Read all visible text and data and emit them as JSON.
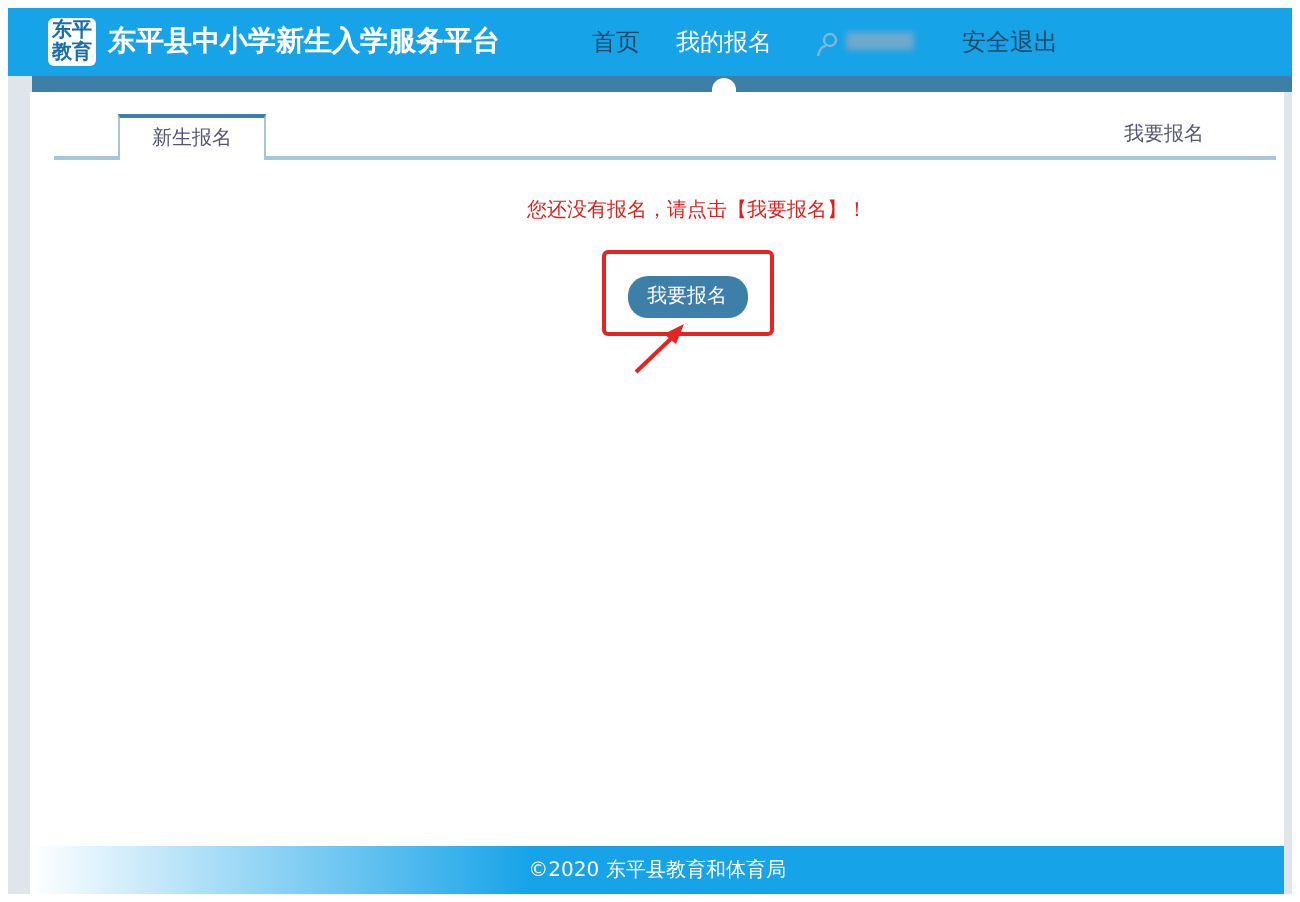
{
  "header": {
    "logo_text": [
      "东平",
      "教育"
    ],
    "title": "东平县中小学新生入学服务平台",
    "nav": [
      {
        "label": "首页",
        "selected": false
      },
      {
        "label": "我的报名",
        "selected": true
      }
    ],
    "user": {
      "name_blurred": true
    },
    "logout": "安全退出"
  },
  "tabs": [
    {
      "label": "新生报名",
      "selected": true
    }
  ],
  "tab_link": "我要报名",
  "message": "您还没有报名，请点击【我要报名】！",
  "button": "我要报名",
  "footer": "©2020  东平县教育和体育局"
}
